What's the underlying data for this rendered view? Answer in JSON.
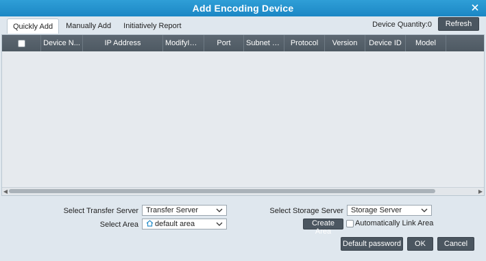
{
  "window": {
    "title": "Add Encoding Device",
    "close_icon": "close-icon"
  },
  "tabs": [
    {
      "label": "Quickly Add",
      "active": true
    },
    {
      "label": "Manually Add",
      "active": false
    },
    {
      "label": "Initiatively Report",
      "active": false
    }
  ],
  "toolbar": {
    "device_quantity": "Device Quantity:0",
    "refresh_label": "Refresh"
  },
  "table": {
    "columns": [
      "",
      "Device N...",
      "IP Address",
      "ModifyIP ...",
      "Port",
      "Subnet M...",
      "Protocol",
      "Version",
      "Device ID",
      "Model"
    ],
    "rows": []
  },
  "form": {
    "transfer_server_label": "Select Transfer Server",
    "transfer_server_value": "Transfer Server",
    "storage_server_label": "Select Storage Server",
    "storage_server_value": "Storage Server",
    "area_label": "Select Area",
    "area_value": "default area",
    "create_area_label": "Create Area",
    "auto_link_label": "Automatically Link Area"
  },
  "footer": {
    "default_password_label": "Default password",
    "ok_label": "OK",
    "cancel_label": "Cancel"
  },
  "colors": {
    "titlebar": "#1b87c4",
    "header": "#4e5962",
    "button": "#4b5660",
    "background": "#dfe7ee"
  }
}
